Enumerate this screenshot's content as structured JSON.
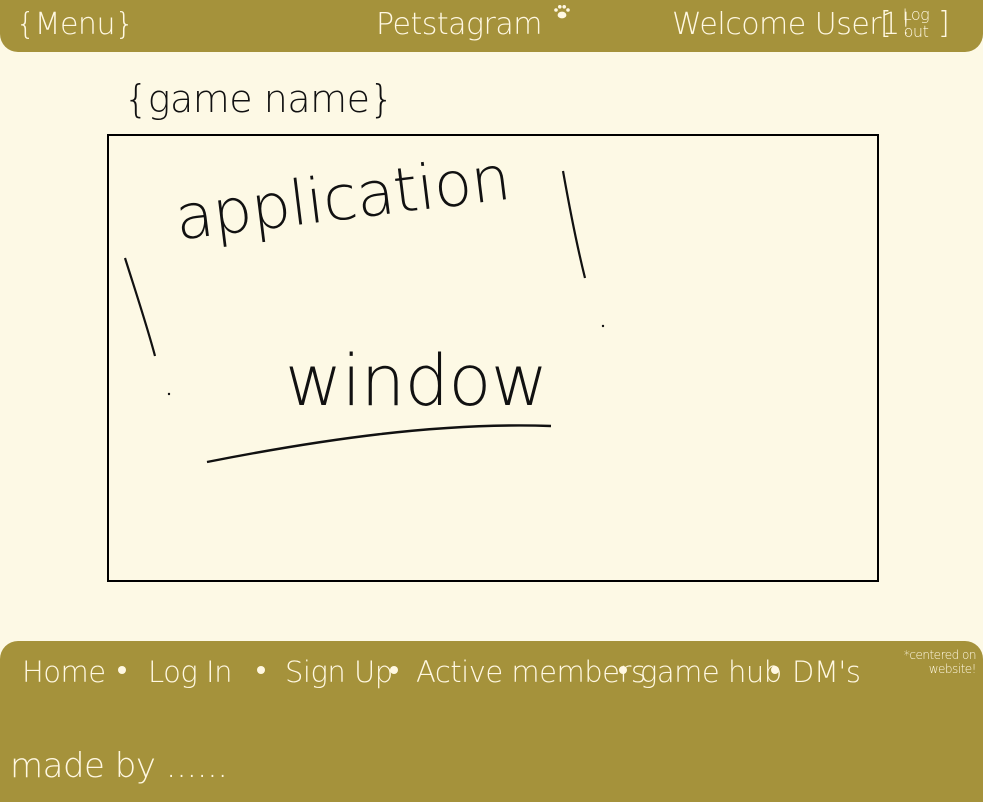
{
  "header": {
    "menu_label": "{Menu}",
    "app_name": "Petstagram",
    "welcome_text": "Welcome User1!",
    "logout_line1": "Log",
    "logout_line2": "out",
    "logout_brackets": [
      "[",
      "]"
    ],
    "paw_icon": "paw-icon"
  },
  "content": {
    "game_title_placeholder": "{game name}",
    "app_window_text_line1": "application",
    "app_window_text_line2": "window"
  },
  "footer": {
    "nav_items": [
      "Home",
      "Log In",
      "Sign Up",
      "Active members",
      "game hub",
      "DM's"
    ],
    "nav_note": "*centered on website!",
    "made_by": "made by ......"
  },
  "colors": {
    "page_background": "#fdf9e5",
    "bar_color": "#a5923b",
    "bar_text": "#fff8e2",
    "ink": "#111111"
  }
}
